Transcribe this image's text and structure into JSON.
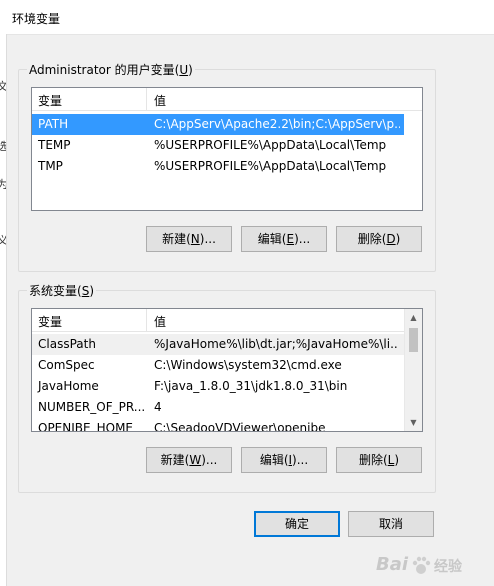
{
  "window": {
    "title": "环境变量"
  },
  "left_edge_chars": [
    "文",
    "选",
    "为",
    "义"
  ],
  "user_vars": {
    "group_title_prefix": "Administrator 的用户变量(",
    "group_title_key": "U",
    "group_title_suffix": ")",
    "columns": [
      "变量",
      "值"
    ],
    "rows": [
      {
        "name": "PATH",
        "value": "C:\\AppServ\\Apache2.2\\bin;C:\\AppServ\\p..."
      },
      {
        "name": "TEMP",
        "value": "%USERPROFILE%\\AppData\\Local\\Temp"
      },
      {
        "name": "TMP",
        "value": "%USERPROFILE%\\AppData\\Local\\Temp"
      }
    ],
    "selected_index": 0,
    "buttons": {
      "new": {
        "pre": "新建(",
        "key": "N",
        "post": ")..."
      },
      "edit": {
        "pre": "编辑(",
        "key": "E",
        "post": ")..."
      },
      "delete": {
        "pre": "删除(",
        "key": "D",
        "post": ")"
      }
    }
  },
  "system_vars": {
    "group_title_prefix": "系统变量(",
    "group_title_key": "S",
    "group_title_suffix": ")",
    "columns": [
      "变量",
      "值"
    ],
    "rows": [
      {
        "name": "ClassPath",
        "value": "%JavaHome%\\lib\\dt.jar;%JavaHome%\\li..."
      },
      {
        "name": "ComSpec",
        "value": "C:\\Windows\\system32\\cmd.exe"
      },
      {
        "name": "JavaHome",
        "value": "F:\\java_1.8.0_31\\jdk1.8.0_31\\bin"
      },
      {
        "name": "NUMBER_OF_PR...",
        "value": "4"
      },
      {
        "name": "OPENIBE_HOME",
        "value": "C:\\SeadooVDViewer\\openibe"
      }
    ],
    "selected_index": 0,
    "buttons": {
      "new": {
        "pre": "新建(",
        "key": "W",
        "post": ")..."
      },
      "edit": {
        "pre": "编辑(",
        "key": "I",
        "post": ")..."
      },
      "delete": {
        "pre": "删除(",
        "key": "L",
        "post": ")"
      }
    }
  },
  "dialog_buttons": {
    "ok": "确定",
    "cancel": "取消"
  },
  "watermark": {
    "text": "Bai",
    "suffix": "经验"
  }
}
